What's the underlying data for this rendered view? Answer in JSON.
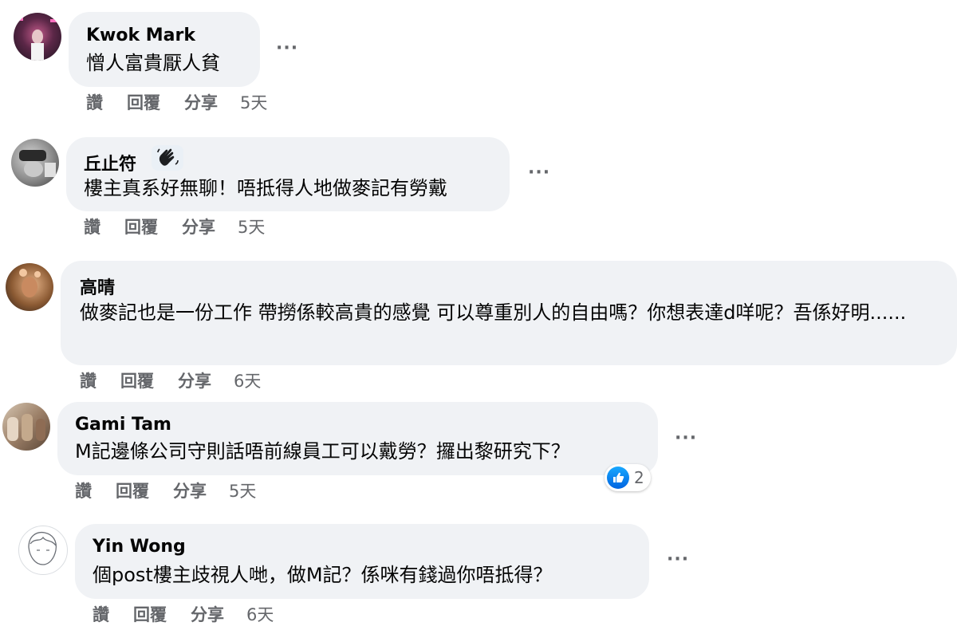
{
  "comments": [
    {
      "author": "Kwok Mark",
      "text": "憎人富貴厭人貧",
      "actions": {
        "like": "讚",
        "reply": "回覆",
        "share": "分享",
        "time": "5天"
      },
      "more": "···"
    },
    {
      "author": "丘止符",
      "text": "樓主真系好無聊！唔抵得人地做麥記有勞戴",
      "actions": {
        "like": "讚",
        "reply": "回覆",
        "share": "分享",
        "time": "5天"
      },
      "more": "···"
    },
    {
      "author": "高晴",
      "text": "做麥記也是一份工作 帶撈係較高貴的感覺 可以尊重別人的自由嗎？你想表達d咩呢？吾係好明......",
      "actions": {
        "like": "讚",
        "reply": "回覆",
        "share": "分享",
        "time": "6天"
      }
    },
    {
      "author": "Gami Tam",
      "text": "M記邊條公司守則話唔前線員工可以戴勞？攞出黎研究下？",
      "actions": {
        "like": "讚",
        "reply": "回覆",
        "share": "分享",
        "time": "5天"
      },
      "reaction_count": "2",
      "more": "···"
    },
    {
      "author": "Yin Wong",
      "text": "個post樓主歧視人哋，做M記？係咪有錢過你唔抵得？",
      "actions": {
        "like": "讚",
        "reply": "回覆",
        "share": "分享",
        "time": "6天"
      },
      "more": "···"
    }
  ]
}
